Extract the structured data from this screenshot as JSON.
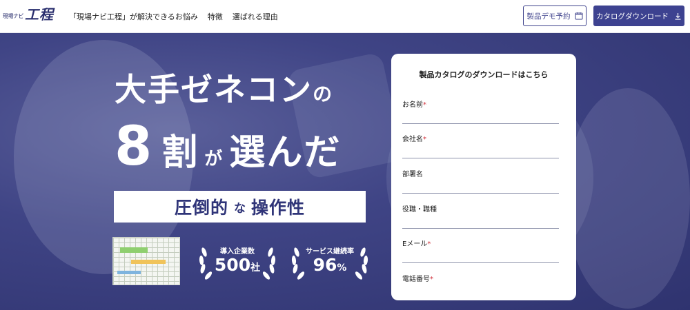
{
  "header": {
    "logo_small": "現場ナビ",
    "logo_main": "工程",
    "nav": [
      {
        "label": "「現場ナビ工程」が解決できるお悩み"
      },
      {
        "label": "特徴"
      },
      {
        "label": "選ばれる理由"
      }
    ],
    "demo_button": "製品デモ予約",
    "catalog_button": "カタログダウンロード"
  },
  "hero": {
    "headline_1": "大手ゼネコン",
    "headline_1_particle": "の",
    "headline_2_number": "8",
    "headline_2_kanji": "割",
    "headline_2_particle": "が",
    "headline_2_verb": "選んだ",
    "tagline_1": "圧倒的",
    "tagline_particle": "な",
    "tagline_2": "操作性",
    "badges": [
      {
        "label": "導入企業数",
        "value": "500",
        "unit": "社"
      },
      {
        "label": "サービス継続率",
        "value": "96",
        "unit": "%"
      }
    ]
  },
  "form": {
    "title": "製品カタログのダウンロードはこちら",
    "required_mark": "*",
    "fields": [
      {
        "label": "お名前",
        "required": true,
        "value": ""
      },
      {
        "label": "会社名",
        "required": true,
        "value": ""
      },
      {
        "label": "部署名",
        "required": false,
        "value": ""
      },
      {
        "label": "役職・職種",
        "required": false,
        "value": ""
      },
      {
        "label": "Eメール",
        "required": true,
        "value": ""
      },
      {
        "label": "電話番号",
        "required": true,
        "value": ""
      }
    ]
  },
  "colors": {
    "brand": "#3d4290",
    "hero_bg": "#3f4485",
    "required": "#d0303a"
  }
}
